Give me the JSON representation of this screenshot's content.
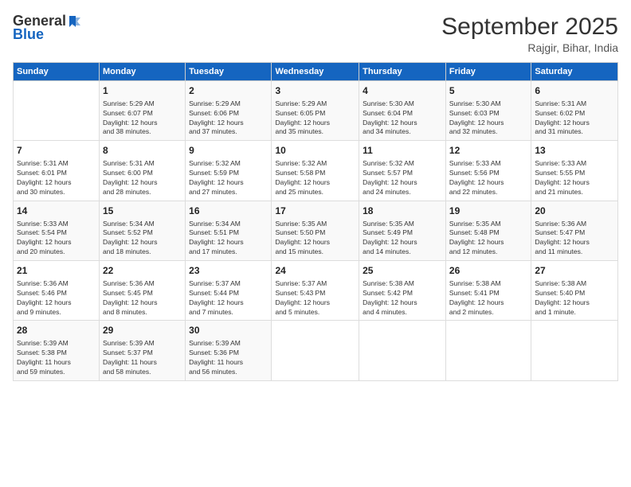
{
  "logo": {
    "line1": "General",
    "line2": "Blue"
  },
  "title": "September 2025",
  "subtitle": "Rajgir, Bihar, India",
  "days_header": [
    "Sunday",
    "Monday",
    "Tuesday",
    "Wednesday",
    "Thursday",
    "Friday",
    "Saturday"
  ],
  "weeks": [
    [
      {
        "day": "",
        "content": ""
      },
      {
        "day": "1",
        "content": "Sunrise: 5:29 AM\nSunset: 6:07 PM\nDaylight: 12 hours\nand 38 minutes."
      },
      {
        "day": "2",
        "content": "Sunrise: 5:29 AM\nSunset: 6:06 PM\nDaylight: 12 hours\nand 37 minutes."
      },
      {
        "day": "3",
        "content": "Sunrise: 5:29 AM\nSunset: 6:05 PM\nDaylight: 12 hours\nand 35 minutes."
      },
      {
        "day": "4",
        "content": "Sunrise: 5:30 AM\nSunset: 6:04 PM\nDaylight: 12 hours\nand 34 minutes."
      },
      {
        "day": "5",
        "content": "Sunrise: 5:30 AM\nSunset: 6:03 PM\nDaylight: 12 hours\nand 32 minutes."
      },
      {
        "day": "6",
        "content": "Sunrise: 5:31 AM\nSunset: 6:02 PM\nDaylight: 12 hours\nand 31 minutes."
      }
    ],
    [
      {
        "day": "7",
        "content": "Sunrise: 5:31 AM\nSunset: 6:01 PM\nDaylight: 12 hours\nand 30 minutes."
      },
      {
        "day": "8",
        "content": "Sunrise: 5:31 AM\nSunset: 6:00 PM\nDaylight: 12 hours\nand 28 minutes."
      },
      {
        "day": "9",
        "content": "Sunrise: 5:32 AM\nSunset: 5:59 PM\nDaylight: 12 hours\nand 27 minutes."
      },
      {
        "day": "10",
        "content": "Sunrise: 5:32 AM\nSunset: 5:58 PM\nDaylight: 12 hours\nand 25 minutes."
      },
      {
        "day": "11",
        "content": "Sunrise: 5:32 AM\nSunset: 5:57 PM\nDaylight: 12 hours\nand 24 minutes."
      },
      {
        "day": "12",
        "content": "Sunrise: 5:33 AM\nSunset: 5:56 PM\nDaylight: 12 hours\nand 22 minutes."
      },
      {
        "day": "13",
        "content": "Sunrise: 5:33 AM\nSunset: 5:55 PM\nDaylight: 12 hours\nand 21 minutes."
      }
    ],
    [
      {
        "day": "14",
        "content": "Sunrise: 5:33 AM\nSunset: 5:54 PM\nDaylight: 12 hours\nand 20 minutes."
      },
      {
        "day": "15",
        "content": "Sunrise: 5:34 AM\nSunset: 5:52 PM\nDaylight: 12 hours\nand 18 minutes."
      },
      {
        "day": "16",
        "content": "Sunrise: 5:34 AM\nSunset: 5:51 PM\nDaylight: 12 hours\nand 17 minutes."
      },
      {
        "day": "17",
        "content": "Sunrise: 5:35 AM\nSunset: 5:50 PM\nDaylight: 12 hours\nand 15 minutes."
      },
      {
        "day": "18",
        "content": "Sunrise: 5:35 AM\nSunset: 5:49 PM\nDaylight: 12 hours\nand 14 minutes."
      },
      {
        "day": "19",
        "content": "Sunrise: 5:35 AM\nSunset: 5:48 PM\nDaylight: 12 hours\nand 12 minutes."
      },
      {
        "day": "20",
        "content": "Sunrise: 5:36 AM\nSunset: 5:47 PM\nDaylight: 12 hours\nand 11 minutes."
      }
    ],
    [
      {
        "day": "21",
        "content": "Sunrise: 5:36 AM\nSunset: 5:46 PM\nDaylight: 12 hours\nand 9 minutes."
      },
      {
        "day": "22",
        "content": "Sunrise: 5:36 AM\nSunset: 5:45 PM\nDaylight: 12 hours\nand 8 minutes."
      },
      {
        "day": "23",
        "content": "Sunrise: 5:37 AM\nSunset: 5:44 PM\nDaylight: 12 hours\nand 7 minutes."
      },
      {
        "day": "24",
        "content": "Sunrise: 5:37 AM\nSunset: 5:43 PM\nDaylight: 12 hours\nand 5 minutes."
      },
      {
        "day": "25",
        "content": "Sunrise: 5:38 AM\nSunset: 5:42 PM\nDaylight: 12 hours\nand 4 minutes."
      },
      {
        "day": "26",
        "content": "Sunrise: 5:38 AM\nSunset: 5:41 PM\nDaylight: 12 hours\nand 2 minutes."
      },
      {
        "day": "27",
        "content": "Sunrise: 5:38 AM\nSunset: 5:40 PM\nDaylight: 12 hours\nand 1 minute."
      }
    ],
    [
      {
        "day": "28",
        "content": "Sunrise: 5:39 AM\nSunset: 5:38 PM\nDaylight: 11 hours\nand 59 minutes."
      },
      {
        "day": "29",
        "content": "Sunrise: 5:39 AM\nSunset: 5:37 PM\nDaylight: 11 hours\nand 58 minutes."
      },
      {
        "day": "30",
        "content": "Sunrise: 5:39 AM\nSunset: 5:36 PM\nDaylight: 11 hours\nand 56 minutes."
      },
      {
        "day": "",
        "content": ""
      },
      {
        "day": "",
        "content": ""
      },
      {
        "day": "",
        "content": ""
      },
      {
        "day": "",
        "content": ""
      }
    ]
  ]
}
